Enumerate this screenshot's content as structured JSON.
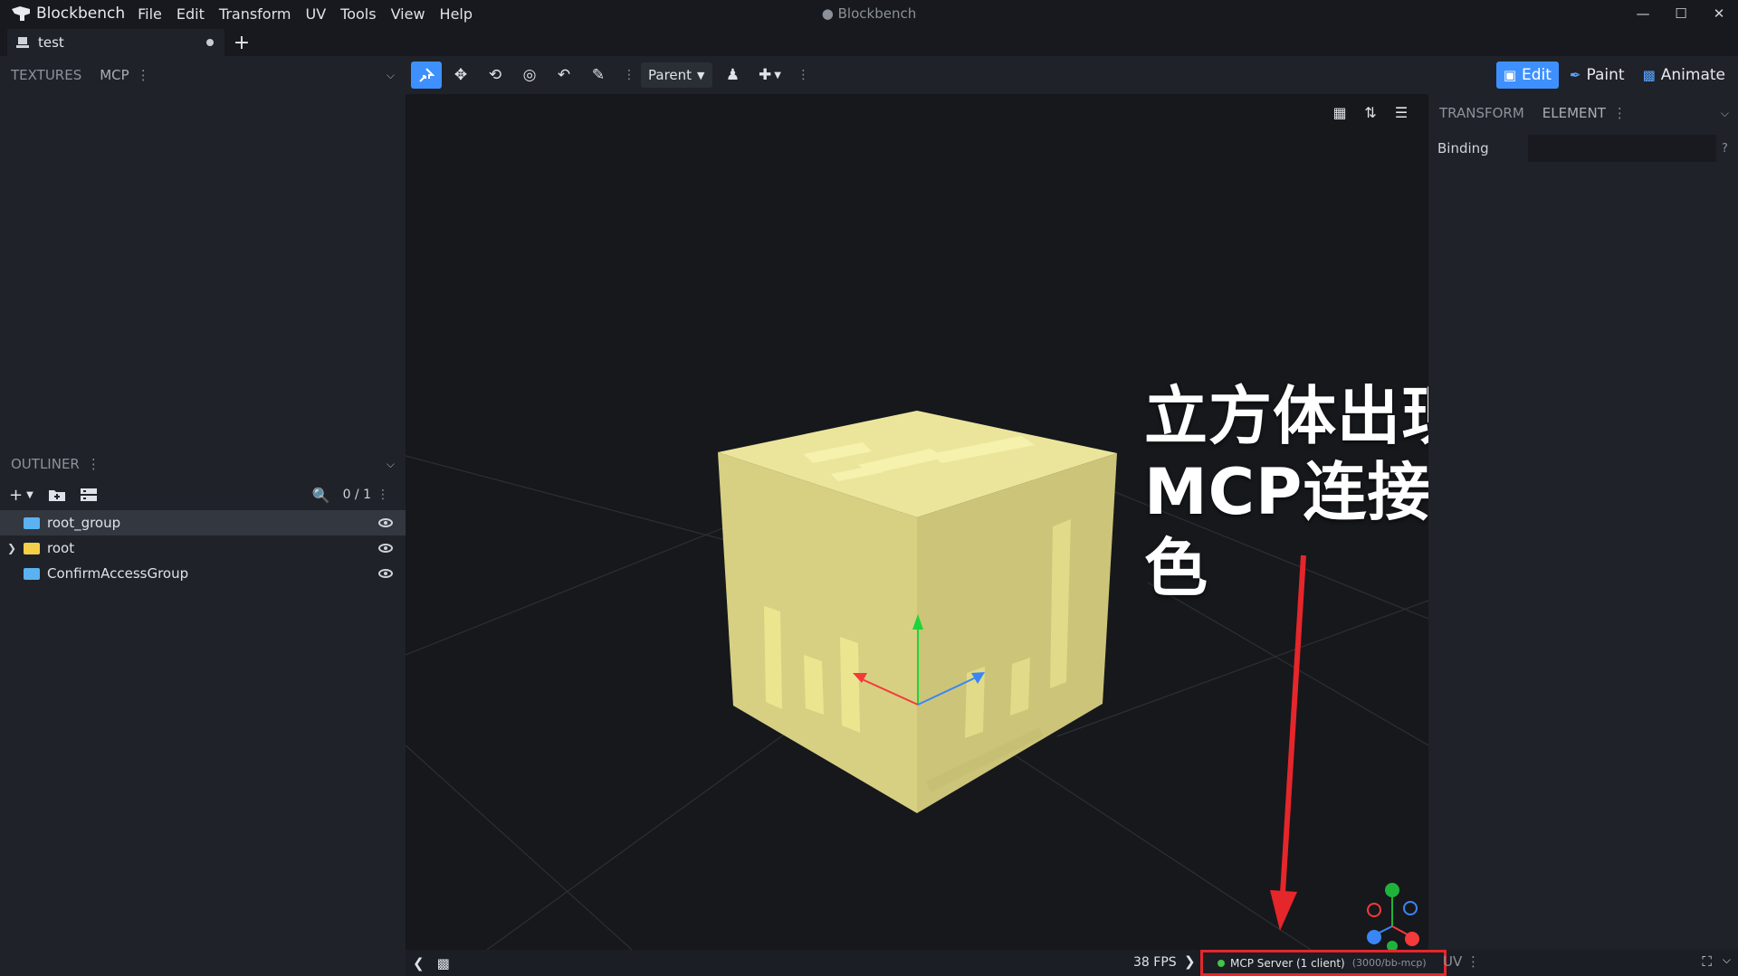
{
  "app": {
    "name": "Blockbench",
    "window_title": "● Blockbench",
    "menu": [
      "File",
      "Edit",
      "Transform",
      "UV",
      "Tools",
      "View",
      "Help"
    ]
  },
  "tabs": [
    {
      "label": "test"
    }
  ],
  "left_panel": {
    "tabs": [
      "TEXTURES",
      "MCP"
    ],
    "outliner": {
      "title": "OUTLINER",
      "count": "0 / 1",
      "items": [
        {
          "label": "root_group",
          "folder_color": "#5ab2f0",
          "selected": true,
          "expandable": false
        },
        {
          "label": "root",
          "folder_color": "#f5cf4a",
          "selected": false,
          "expandable": true
        },
        {
          "label": "ConfirmAccessGroup",
          "folder_color": "#5ab2f0",
          "selected": false,
          "expandable": false
        }
      ]
    }
  },
  "toolbar": {
    "pivot_select": "Parent",
    "modes": [
      {
        "label": "Edit",
        "icon": "cube-icon",
        "active": true
      },
      {
        "label": "Paint",
        "icon": "brush-icon",
        "active": false
      },
      {
        "label": "Animate",
        "icon": "film-icon",
        "active": false
      }
    ]
  },
  "right_panel": {
    "tabs": [
      "TRANSFORM",
      "ELEMENT"
    ],
    "binding_label": "Binding",
    "binding_help": "?"
  },
  "annotation": {
    "line1": "立方体出现",
    "line2": "MCP连接状态是绿色"
  },
  "statusbar": {
    "fps": "38 FPS",
    "mcp_status": "MCP Server (1 client)",
    "mcp_path": "(3000/bb-mcp)",
    "uv_label": "UV"
  },
  "colors": {
    "accent": "#3e90ff",
    "mcp_ok": "#45c34b",
    "highlight_red": "#e5262b",
    "cube_top": "#e9e39a",
    "cube_side": "#ded884"
  }
}
